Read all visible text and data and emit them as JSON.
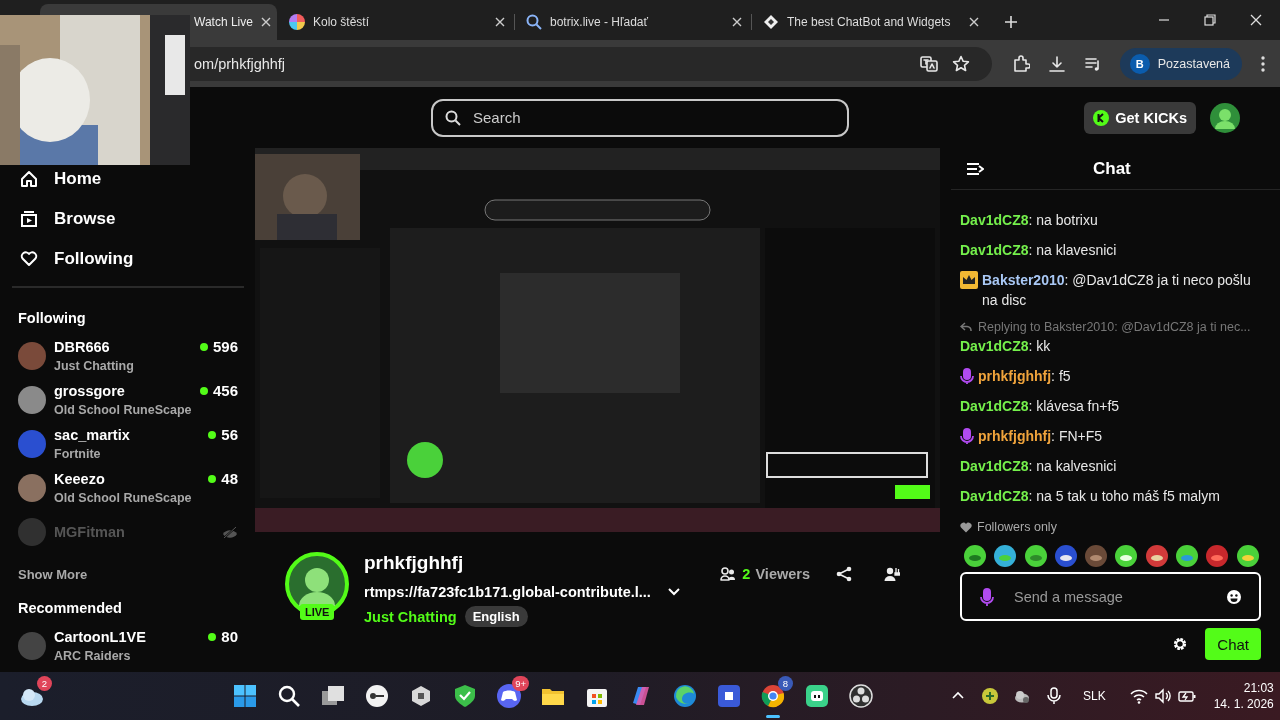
{
  "browser": {
    "tabs": [
      {
        "title": "Watch Live",
        "selected": true
      },
      {
        "title": "Kolo štěstí",
        "selected": false,
        "kind": "wheel"
      },
      {
        "title": "botrix.live - Hľadať",
        "selected": false,
        "kind": "search"
      },
      {
        "title": "The best ChatBot and Widgets",
        "selected": false,
        "kind": "diamond"
      }
    ],
    "address": "om/prhkfjghhfj",
    "profile": {
      "initial": "B",
      "label": "Pozastavená"
    }
  },
  "topbar": {
    "search_placeholder": "Search",
    "get_kicks": "Get KICKs"
  },
  "sidebar": {
    "nav": [
      {
        "label": "Home",
        "kind": "home"
      },
      {
        "label": "Browse",
        "kind": "browse"
      },
      {
        "label": "Following",
        "kind": "heart"
      }
    ],
    "following_title": "Following",
    "following": [
      {
        "name": "DBR666",
        "category": "Just Chatting",
        "viewers": "596",
        "live": true
      },
      {
        "name": "grossgore",
        "category": "Old School RuneScape",
        "viewers": "456",
        "live": true
      },
      {
        "name": "sac_martix",
        "category": "Fortnite",
        "viewers": "56",
        "live": true
      },
      {
        "name": "Keeezo",
        "category": "Old School RuneScape",
        "viewers": "48",
        "live": true
      },
      {
        "name": "MGFitman",
        "live": false
      }
    ],
    "show_more": "Show More",
    "recommended_title": "Recommended",
    "recommended": [
      {
        "name": "CartoonL1VE",
        "category": "ARC Raiders",
        "viewers": "80",
        "live": true
      }
    ]
  },
  "stream": {
    "channel": "prhkfjghhfj",
    "live_badge": "LIVE",
    "title": "rtmps://fa723fc1b171.global-contribute.l...",
    "category": "Just Chatting",
    "tags": [
      "English"
    ],
    "viewer_count": "2",
    "viewer_label": "Viewers"
  },
  "chat": {
    "title": "Chat",
    "messages": [
      {
        "kind": "plain",
        "user": "Dav1dCZ8",
        "color": "#75f04c",
        "text": ": na botrixu"
      },
      {
        "kind": "plain",
        "user": "Dav1dCZ8",
        "color": "#75f04c",
        "text": ": na klavesnici"
      },
      {
        "kind": "crown",
        "user": "Bakster2010",
        "color": "#a9c8f5",
        "text": ": @Dav1dCZ8 ja ti neco pošlu na disc"
      },
      {
        "kind": "plain",
        "user": "Dav1dCZ8",
        "color": "#75f04c",
        "reply": "Replying to Bakster2010: @Dav1dCZ8 ja ti nec...",
        "text": ": kk"
      },
      {
        "kind": "mic",
        "user": "prhkfjghhfj",
        "color": "#f0a43c",
        "text": ": f5"
      },
      {
        "kind": "plain",
        "user": "Dav1dCZ8",
        "color": "#75f04c",
        "text": ": klávesa fn+f5"
      },
      {
        "kind": "mic",
        "user": "prhkfjghhfj",
        "color": "#f0a43c",
        "text": ": FN+F5"
      },
      {
        "kind": "plain",
        "user": "Dav1dCZ8",
        "color": "#75f04c",
        "text": ": na kalvesnici"
      },
      {
        "kind": "plain",
        "user": "Dav1dCZ8",
        "color": "#75f04c",
        "text": ": na 5 tak u toho máš f5 malym"
      }
    ],
    "mode": "Followers only",
    "input_placeholder": "Send a message",
    "send_button": "Chat"
  },
  "taskbar": {
    "weather_badge": "2",
    "discord_badge": "9+",
    "chrome_badge": "8",
    "language": "SLK",
    "time": "21:03",
    "date": "14. 1. 2026"
  }
}
